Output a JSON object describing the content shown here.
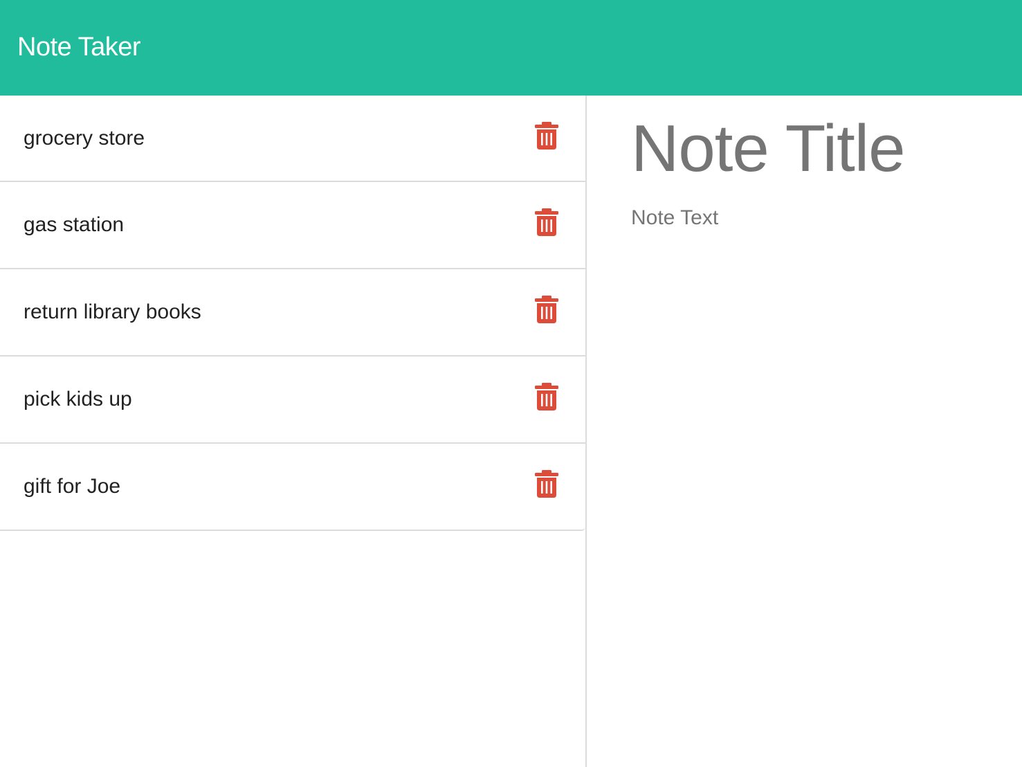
{
  "app": {
    "brand": "Note Taker",
    "accent_color": "#20BC9C",
    "delete_color": "#DD4B39"
  },
  "notes": [
    {
      "title": "grocery store"
    },
    {
      "title": "gas station"
    },
    {
      "title": "return library books"
    },
    {
      "title": "pick kids up"
    },
    {
      "title": "gift for Joe"
    }
  ],
  "editor": {
    "title_placeholder": "Note Title",
    "text_placeholder": "Note Text"
  },
  "icons": {
    "delete": "trash-icon"
  }
}
